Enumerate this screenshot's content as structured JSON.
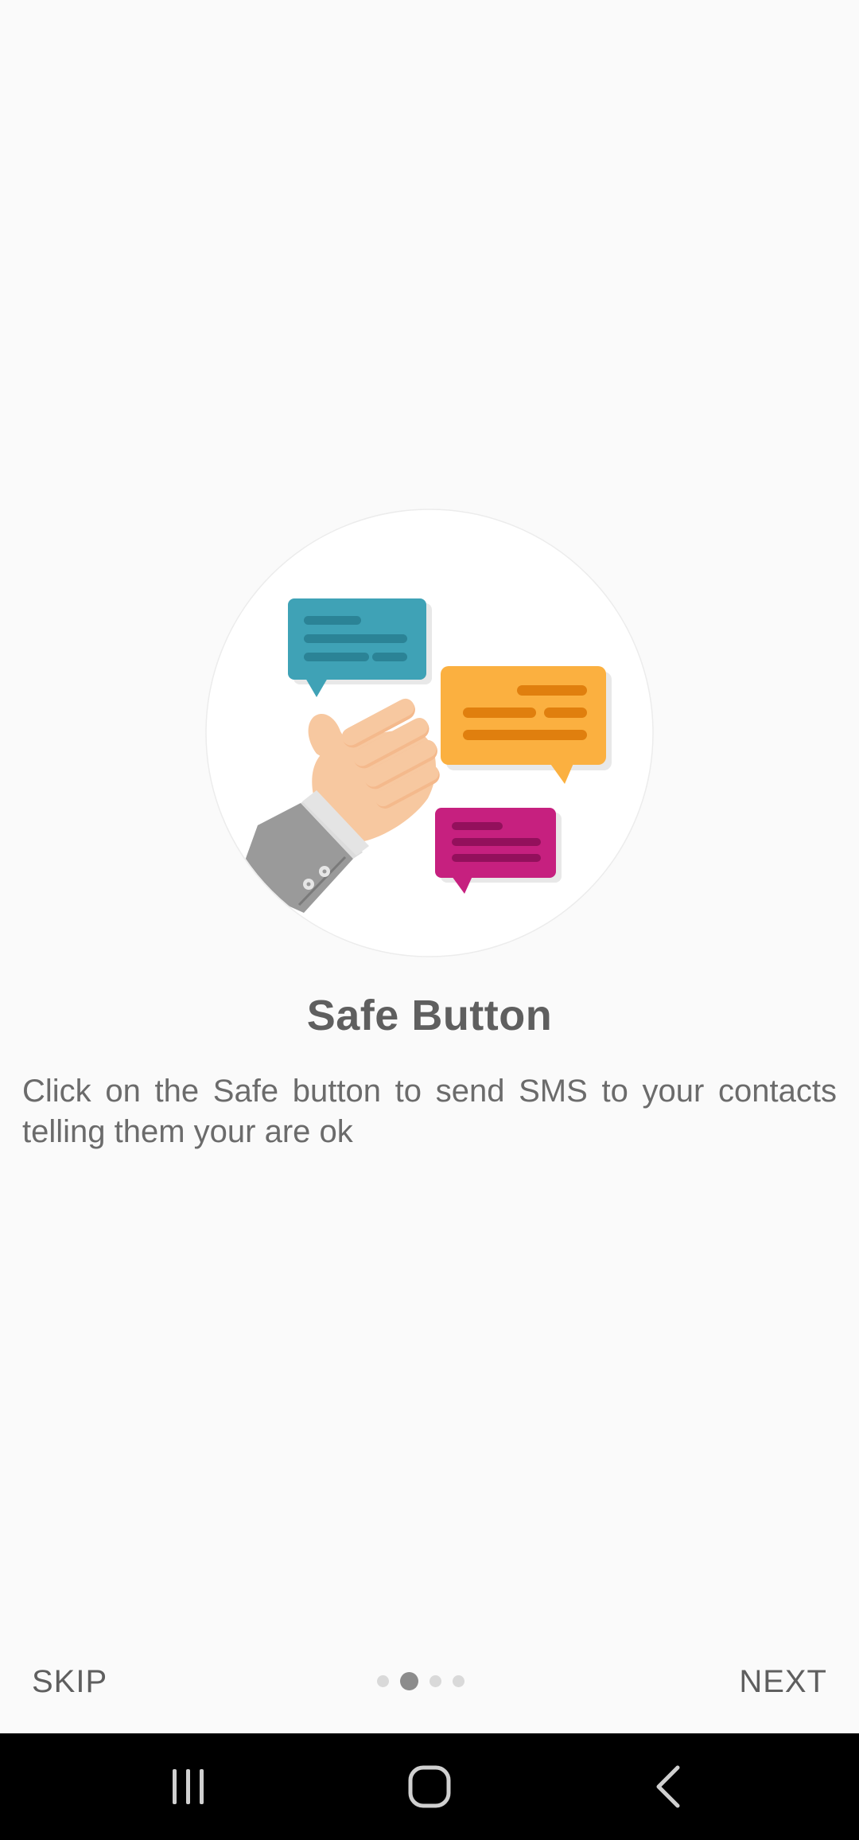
{
  "onboarding": {
    "title": "Safe Button",
    "description": "Click on the Safe button to send SMS to your contacts telling them your are ok",
    "illustration": "thumbs-up-chat-bubbles",
    "bubble_colors": {
      "teal": "#3fa2b6",
      "orange": "#fbb040",
      "magenta": "#c6207f"
    }
  },
  "footer": {
    "skip_label": "SKIP",
    "next_label": "NEXT",
    "pages_total": 4,
    "current_page": 2
  },
  "navbar": {
    "recents_icon": "recents-icon",
    "home_icon": "home-icon",
    "back_icon": "back-icon"
  }
}
